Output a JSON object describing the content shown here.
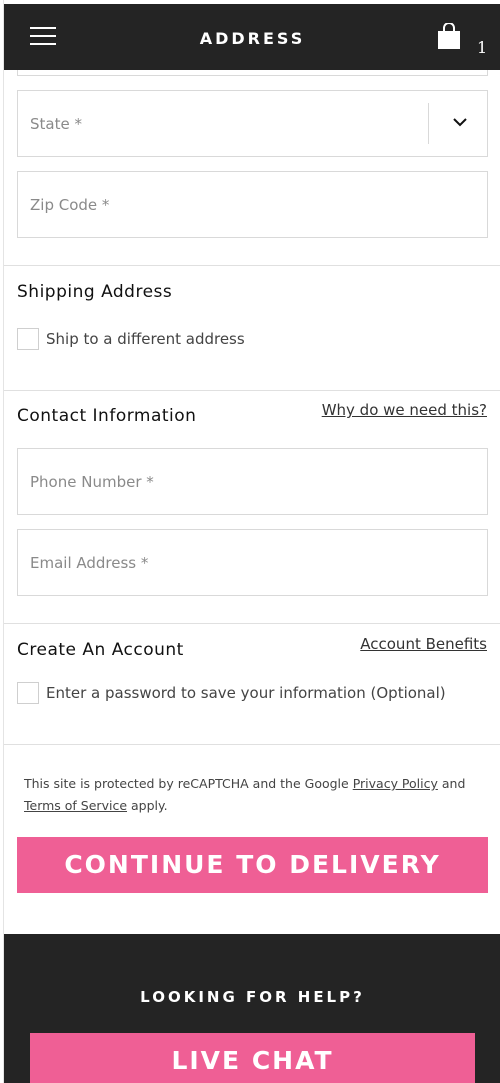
{
  "header": {
    "title": "ADDRESS",
    "cart_count": "1",
    "menu_icon": "hamburger-menu-icon",
    "bag_icon": "shopping-bag-icon"
  },
  "billing": {
    "state_placeholder": "State *",
    "zip_placeholder": "Zip Code *"
  },
  "shipping": {
    "title": "Shipping Address",
    "checkbox_label": "Ship to a different address"
  },
  "contact": {
    "title": "Contact Information",
    "why_link": "Why do we need this?",
    "phone_placeholder": "Phone Number *",
    "email_placeholder": "Email Address *"
  },
  "account": {
    "title": "Create An Account",
    "benefits_link": "Account Benefits",
    "checkbox_label": "Enter a password to save your information (Optional)"
  },
  "recaptcha": {
    "prefix": "This site is protected by reCAPTCHA and the Google ",
    "privacy_link": "Privacy Policy",
    "middle": " and ",
    "terms_link": "Terms of Service",
    "suffix": " apply."
  },
  "cta": {
    "continue_label": "CONTINUE TO DELIVERY"
  },
  "footer": {
    "title": "LOOKING FOR HELP?",
    "live_chat_label": "LIVE CHAT"
  },
  "colors": {
    "header_bg": "#242424",
    "accent_pink": "#ef5f95"
  }
}
